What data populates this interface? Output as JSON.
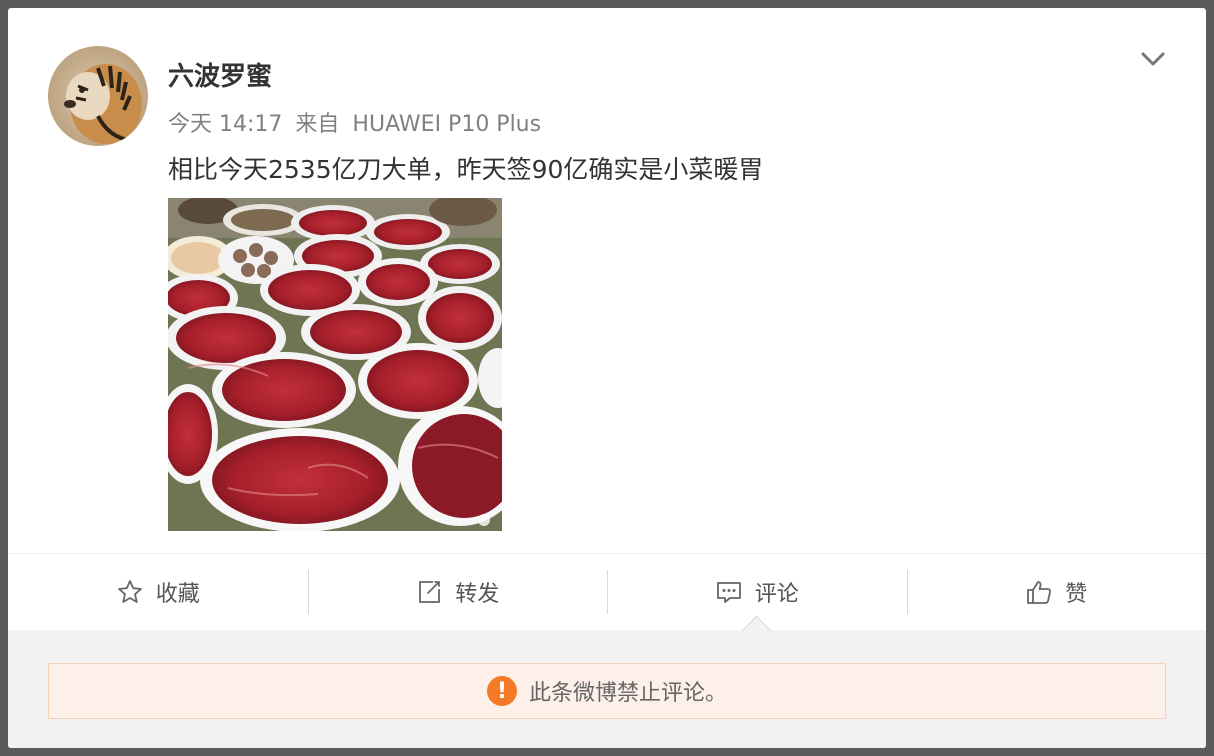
{
  "post": {
    "author": "六波罗蜜",
    "time": "今天 14:17",
    "source_prefix": "来自",
    "source": "HUAWEI P10 Plus",
    "text": "相比今天2535亿刀大单，昨天签90亿确实是小菜暖胃"
  },
  "actions": [
    {
      "label": "收藏",
      "icon": "star-icon"
    },
    {
      "label": "转发",
      "icon": "share-icon"
    },
    {
      "label": "评论",
      "icon": "comment-icon"
    },
    {
      "label": "赞",
      "icon": "thumbs-up-icon"
    }
  ],
  "notice": {
    "text": "此条微博禁止评论。",
    "icon": "!"
  },
  "colors": {
    "accent_orange": "#f47a25",
    "notice_bg": "#fdf0e8"
  }
}
